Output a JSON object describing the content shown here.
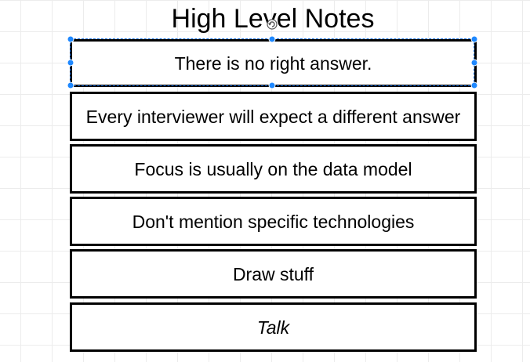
{
  "diagram": {
    "title": "High Level Notes",
    "notes": [
      {
        "text": "There is no right answer.",
        "selected": true
      },
      {
        "text": "Every interviewer will expect a different answer",
        "selected": false
      },
      {
        "text": "Focus is usually on the data model",
        "selected": false
      },
      {
        "text": "Don't mention specific technologies",
        "selected": false
      },
      {
        "text": "Draw stuff",
        "selected": false
      },
      {
        "text": "Talk",
        "selected": false
      }
    ],
    "colors": {
      "selection": "#1e88ff",
      "border": "#000000",
      "grid": "#ececec"
    },
    "icons": {
      "rotate": "rotate-icon"
    }
  }
}
